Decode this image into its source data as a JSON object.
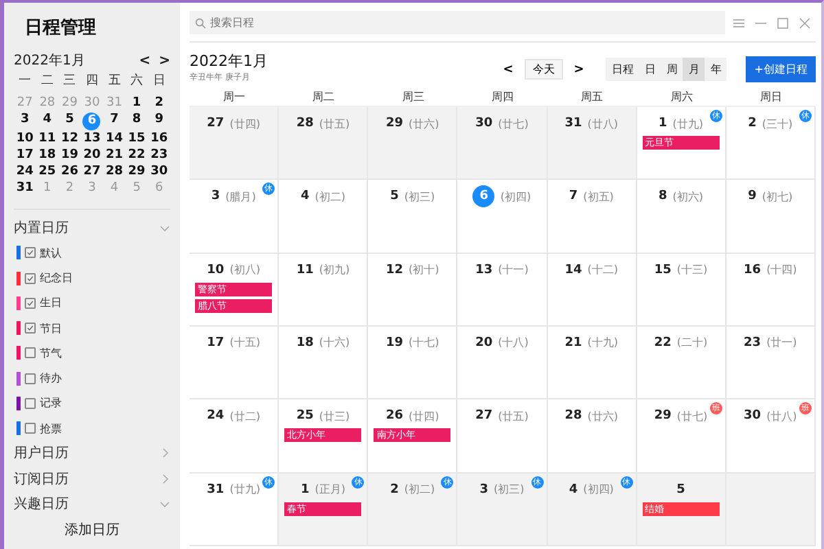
{
  "sidebar": {
    "title": "日程管理",
    "mini_calendar": {
      "month": "2022年1月",
      "prev": "<",
      "next": ">",
      "weekdays": [
        "一",
        "二",
        "三",
        "四",
        "五",
        "六",
        "日"
      ],
      "days": [
        {
          "label": "27",
          "muted": true,
          "selected": false
        },
        {
          "label": "28",
          "muted": true,
          "selected": false
        },
        {
          "label": "29",
          "muted": true,
          "selected": false
        },
        {
          "label": "30",
          "muted": true,
          "selected": false
        },
        {
          "label": "31",
          "muted": true,
          "selected": false
        },
        {
          "label": "1",
          "muted": false,
          "selected": false
        },
        {
          "label": "2",
          "muted": false,
          "selected": false
        },
        {
          "label": "3",
          "muted": false,
          "selected": false
        },
        {
          "label": "4",
          "muted": false,
          "selected": false
        },
        {
          "label": "5",
          "muted": false,
          "selected": false
        },
        {
          "label": "6",
          "muted": false,
          "selected": true
        },
        {
          "label": "7",
          "muted": false,
          "selected": false
        },
        {
          "label": "8",
          "muted": false,
          "selected": false
        },
        {
          "label": "9",
          "muted": false,
          "selected": false
        },
        {
          "label": "10",
          "muted": false,
          "selected": false
        },
        {
          "label": "11",
          "muted": false,
          "selected": false
        },
        {
          "label": "12",
          "muted": false,
          "selected": false
        },
        {
          "label": "13",
          "muted": false,
          "selected": false
        },
        {
          "label": "14",
          "muted": false,
          "selected": false
        },
        {
          "label": "15",
          "muted": false,
          "selected": false
        },
        {
          "label": "16",
          "muted": false,
          "selected": false
        },
        {
          "label": "17",
          "muted": false,
          "selected": false
        },
        {
          "label": "18",
          "muted": false,
          "selected": false
        },
        {
          "label": "19",
          "muted": false,
          "selected": false
        },
        {
          "label": "20",
          "muted": false,
          "selected": false
        },
        {
          "label": "21",
          "muted": false,
          "selected": false
        },
        {
          "label": "22",
          "muted": false,
          "selected": false
        },
        {
          "label": "23",
          "muted": false,
          "selected": false
        },
        {
          "label": "24",
          "muted": false,
          "selected": false
        },
        {
          "label": "25",
          "muted": false,
          "selected": false
        },
        {
          "label": "26",
          "muted": false,
          "selected": false
        },
        {
          "label": "27",
          "muted": false,
          "selected": false
        },
        {
          "label": "28",
          "muted": false,
          "selected": false
        },
        {
          "label": "29",
          "muted": false,
          "selected": false
        },
        {
          "label": "30",
          "muted": false,
          "selected": false
        },
        {
          "label": "31",
          "muted": false,
          "selected": false
        },
        {
          "label": "1",
          "muted": true,
          "selected": false
        },
        {
          "label": "2",
          "muted": true,
          "selected": false
        },
        {
          "label": "3",
          "muted": true,
          "selected": false
        },
        {
          "label": "4",
          "muted": true,
          "selected": false
        },
        {
          "label": "5",
          "muted": true,
          "selected": false
        },
        {
          "label": "6",
          "muted": true,
          "selected": false
        }
      ]
    },
    "groups": [
      {
        "label": "内置日历",
        "expanded": true,
        "items": [
          {
            "label": "默认",
            "checked": true,
            "color": "#1a6fe0"
          },
          {
            "label": "纪念日",
            "checked": true,
            "color": "#ff2d3c"
          },
          {
            "label": "生日",
            "checked": true,
            "color": "#ff3d8b"
          },
          {
            "label": "节日",
            "checked": true,
            "color": "#f0145a"
          },
          {
            "label": "节气",
            "checked": false,
            "color": "#f01464"
          },
          {
            "label": "待办",
            "checked": false,
            "color": "#b24fd6"
          },
          {
            "label": "记录",
            "checked": false,
            "color": "#7a14a8"
          },
          {
            "label": "抢票",
            "checked": false,
            "color": "#1a6fe0"
          }
        ]
      },
      {
        "label": "用户日历",
        "expanded": false
      },
      {
        "label": "订阅日历",
        "expanded": false
      },
      {
        "label": "兴趣日历",
        "expanded": true
      }
    ],
    "add_button": "添加日历"
  },
  "search": {
    "placeholder": "搜索日程"
  },
  "header": {
    "title": "2022年1月",
    "subtitle": "辛丑牛年 庚子月",
    "prev": "<",
    "today": "今天",
    "next": ">",
    "views": [
      {
        "label": "日程",
        "selected": false
      },
      {
        "label": "日",
        "selected": false
      },
      {
        "label": "周",
        "selected": false
      },
      {
        "label": "月",
        "selected": true
      },
      {
        "label": "年",
        "selected": false
      }
    ],
    "create_button": "+创建日程"
  },
  "weekdays": [
    "周一",
    "周二",
    "周三",
    "周四",
    "周五",
    "周六",
    "周日"
  ],
  "days": [
    {
      "day": "27",
      "lunar": "(廿四)",
      "other_month": true,
      "today": false
    },
    {
      "day": "28",
      "lunar": "(廿五)",
      "other_month": true,
      "today": false
    },
    {
      "day": "29",
      "lunar": "(廿六)",
      "other_month": true,
      "today": false
    },
    {
      "day": "30",
      "lunar": "(廿七)",
      "other_month": true,
      "today": false
    },
    {
      "day": "31",
      "lunar": "(廿八)",
      "other_month": true,
      "today": false
    },
    {
      "day": "1",
      "lunar": "(廿九)",
      "other_month": false,
      "today": false,
      "badge": {
        "kind": "rest",
        "text": "休"
      },
      "events": [
        {
          "title": "元旦节",
          "color": "#e91e63"
        }
      ]
    },
    {
      "day": "2",
      "lunar": "(三十)",
      "other_month": false,
      "today": false,
      "badge": {
        "kind": "rest",
        "text": "休"
      }
    },
    {
      "day": "3",
      "lunar": "(腊月)",
      "other_month": false,
      "today": false,
      "badge": {
        "kind": "rest",
        "text": "休"
      }
    },
    {
      "day": "4",
      "lunar": "(初二)",
      "other_month": false,
      "today": false
    },
    {
      "day": "5",
      "lunar": "(初三)",
      "other_month": false,
      "today": false
    },
    {
      "day": "6",
      "lunar": "(初四)",
      "other_month": false,
      "today": true
    },
    {
      "day": "7",
      "lunar": "(初五)",
      "other_month": false,
      "today": false
    },
    {
      "day": "8",
      "lunar": "(初六)",
      "other_month": false,
      "today": false
    },
    {
      "day": "9",
      "lunar": "(初七)",
      "other_month": false,
      "today": false
    },
    {
      "day": "10",
      "lunar": "(初八)",
      "other_month": false,
      "today": false,
      "events": [
        {
          "title": "警察节",
          "color": "#e91e63"
        },
        {
          "title": "腊八节",
          "color": "#e91e63"
        }
      ]
    },
    {
      "day": "11",
      "lunar": "(初九)",
      "other_month": false,
      "today": false
    },
    {
      "day": "12",
      "lunar": "(初十)",
      "other_month": false,
      "today": false
    },
    {
      "day": "13",
      "lunar": "(十一)",
      "other_month": false,
      "today": false
    },
    {
      "day": "14",
      "lunar": "(十二)",
      "other_month": false,
      "today": false
    },
    {
      "day": "15",
      "lunar": "(十三)",
      "other_month": false,
      "today": false
    },
    {
      "day": "16",
      "lunar": "(十四)",
      "other_month": false,
      "today": false
    },
    {
      "day": "17",
      "lunar": "(十五)",
      "other_month": false,
      "today": false
    },
    {
      "day": "18",
      "lunar": "(十六)",
      "other_month": false,
      "today": false
    },
    {
      "day": "19",
      "lunar": "(十七)",
      "other_month": false,
      "today": false
    },
    {
      "day": "20",
      "lunar": "(十八)",
      "other_month": false,
      "today": false
    },
    {
      "day": "21",
      "lunar": "(十九)",
      "other_month": false,
      "today": false
    },
    {
      "day": "22",
      "lunar": "(二十)",
      "other_month": false,
      "today": false
    },
    {
      "day": "23",
      "lunar": "(廿一)",
      "other_month": false,
      "today": false
    },
    {
      "day": "24",
      "lunar": "(廿二)",
      "other_month": false,
      "today": false
    },
    {
      "day": "25",
      "lunar": "(廿三)",
      "other_month": false,
      "today": false,
      "events": [
        {
          "title": "北方小年",
          "color": "#e91e63"
        }
      ]
    },
    {
      "day": "26",
      "lunar": "(廿四)",
      "other_month": false,
      "today": false,
      "events": [
        {
          "title": "南方小年",
          "color": "#e91e63"
        }
      ]
    },
    {
      "day": "27",
      "lunar": "(廿五)",
      "other_month": false,
      "today": false
    },
    {
      "day": "28",
      "lunar": "(廿六)",
      "other_month": false,
      "today": false
    },
    {
      "day": "29",
      "lunar": "(廿七)",
      "other_month": false,
      "today": false,
      "badge": {
        "kind": "work",
        "text": "班"
      }
    },
    {
      "day": "30",
      "lunar": "(廿八)",
      "other_month": false,
      "today": false,
      "badge": {
        "kind": "work",
        "text": "班"
      }
    },
    {
      "day": "31",
      "lunar": "(廿九)",
      "other_month": false,
      "today": false,
      "badge": {
        "kind": "rest",
        "text": "休"
      }
    },
    {
      "day": "1",
      "lunar": "(正月)",
      "other_month": true,
      "today": false,
      "badge": {
        "kind": "rest",
        "text": "休"
      },
      "events": [
        {
          "title": "春节",
          "color": "#e91e63"
        }
      ]
    },
    {
      "day": "2",
      "lunar": "(初二)",
      "other_month": true,
      "today": false,
      "badge": {
        "kind": "rest",
        "text": "休"
      }
    },
    {
      "day": "3",
      "lunar": "(初三)",
      "other_month": true,
      "today": false,
      "badge": {
        "kind": "rest",
        "text": "休"
      }
    },
    {
      "day": "4",
      "lunar": "(初四)",
      "other_month": true,
      "today": false,
      "badge": {
        "kind": "rest",
        "text": "休"
      }
    },
    {
      "day": "5",
      "other_month": true,
      "today": false,
      "events": [
        {
          "title": "结婚",
          "color": "#ff3b4a"
        }
      ]
    },
    {
      "other_month": true
    }
  ]
}
